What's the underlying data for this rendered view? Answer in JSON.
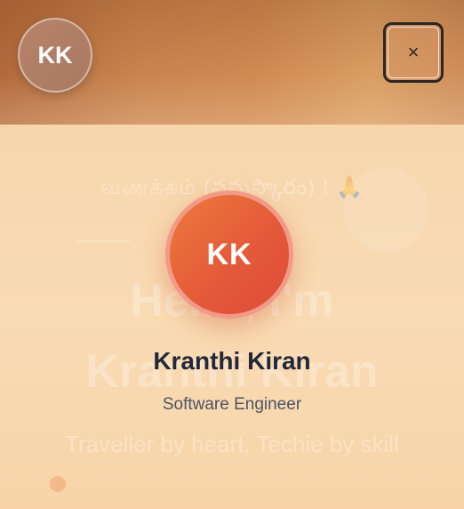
{
  "header": {
    "avatar_initials": "KK",
    "close_icon": "×"
  },
  "background": {
    "greeting": "வணக்கம் (నమస్కారం) ! 🙏",
    "hello": "Hello, I'm",
    "name": "Kranthi Kiran",
    "tagline": "Traveller by heart, Techie by skill"
  },
  "profile": {
    "initials": "KK",
    "name": "Kranthi Kiran",
    "role": "Software Engineer"
  },
  "colors": {
    "accent": "#e55a3a",
    "avatar_ring": "#f29a88",
    "name_text": "#22283a",
    "role_text": "#4c5466",
    "background": "#f8d8ad"
  }
}
